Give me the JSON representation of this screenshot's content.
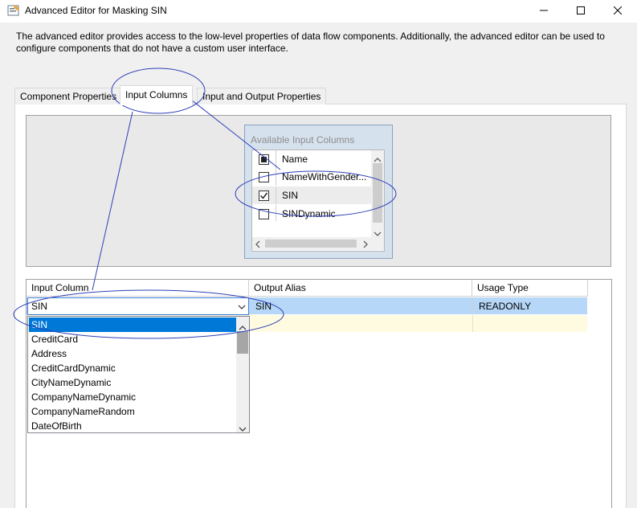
{
  "window": {
    "title": "Advanced Editor for Masking SIN",
    "controls": {
      "minimize": "minimize-icon",
      "maximize": "maximize-icon",
      "close": "close-icon"
    }
  },
  "description": "The advanced editor provides access to the low-level properties of data flow components. Additionally, the advanced editor can be used to configure components that do not have a custom user interface.",
  "tabs": [
    {
      "label": "Component Properties",
      "active": false
    },
    {
      "label": "Input Columns",
      "active": true
    },
    {
      "label": "Input and Output Properties",
      "active": false
    }
  ],
  "available_columns": {
    "title": "Available Input Columns",
    "header": "Name",
    "rows": [
      {
        "label": "NameWithGender...",
        "checked": false
      },
      {
        "label": "SIN",
        "checked": true
      },
      {
        "label": "SINDynamic",
        "checked": false
      }
    ]
  },
  "grid": {
    "columns": [
      "Input Column",
      "Output Alias",
      "Usage Type"
    ],
    "rows": [
      {
        "input": "SIN",
        "alias": "SIN",
        "usage": "READONLY"
      }
    ]
  },
  "dropdown": {
    "items": [
      "SIN",
      "CreditCard",
      "Address",
      "CreditCardDynamic",
      "CityNameDynamic",
      "CompanyNameDynamic",
      "CompanyNameRandom",
      "DateOfBirth"
    ],
    "selected": "SIN"
  },
  "colors": {
    "selection": "#0078d7",
    "row_highlight": "#b6d7f7",
    "new_row": "#fffbe1",
    "annotation": "#2e3fb8"
  }
}
